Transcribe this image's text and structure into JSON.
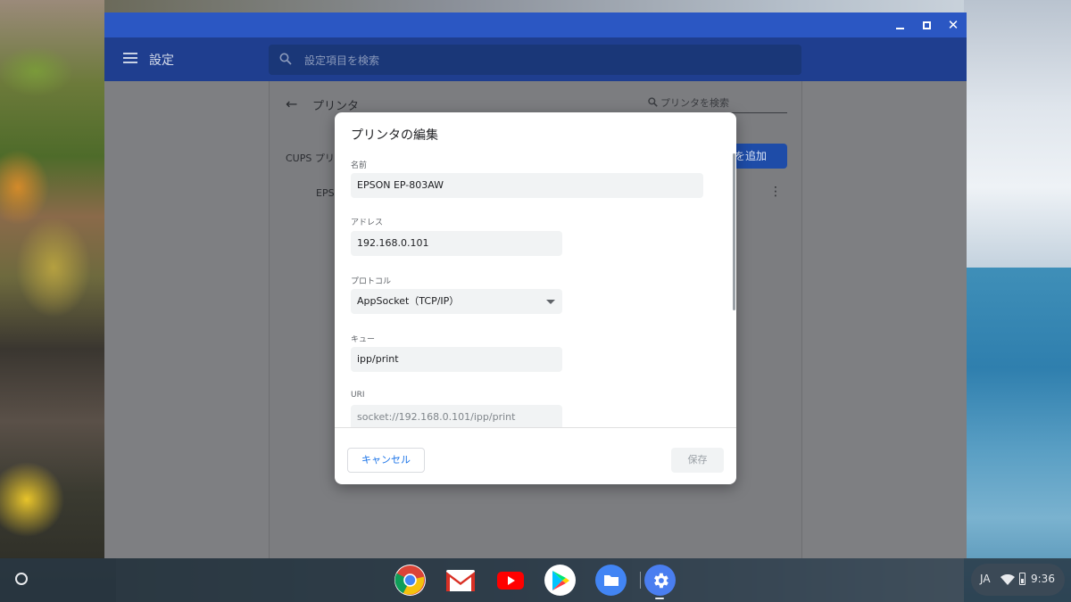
{
  "window": {
    "app_title": "設定",
    "search_placeholder": "設定項目を検索"
  },
  "printers_page": {
    "title": "プリンタ",
    "search_placeholder": "プリンタを検索",
    "cups_label": "CUPS プリ",
    "add_button": "タを追加",
    "printer_row": "EPS"
  },
  "dialog": {
    "title": "プリンタの編集",
    "fields": {
      "name": {
        "label": "名前",
        "value": "EPSON EP-803AW"
      },
      "address": {
        "label": "アドレス",
        "value": "192.168.0.101"
      },
      "protocol": {
        "label": "プロトコル",
        "value": "AppSocket（TCP/IP）"
      },
      "queue": {
        "label": "キュー",
        "value": "ipp/print"
      },
      "uri": {
        "label": "URI",
        "value": "socket://192.168.0.101/ipp/print"
      }
    },
    "cancel_label": "キャンセル",
    "save_label": "保存"
  },
  "shelf": {
    "apps": [
      "chrome-icon",
      "gmail-icon",
      "youtube-icon",
      "play-store-icon",
      "files-icon",
      "settings-icon"
    ],
    "tray": {
      "language": "JA",
      "time": "9:36"
    }
  },
  "colors": {
    "titlebar": "#2b57c3",
    "appbar": "#1f3e8f",
    "accent": "#1a73e8"
  }
}
